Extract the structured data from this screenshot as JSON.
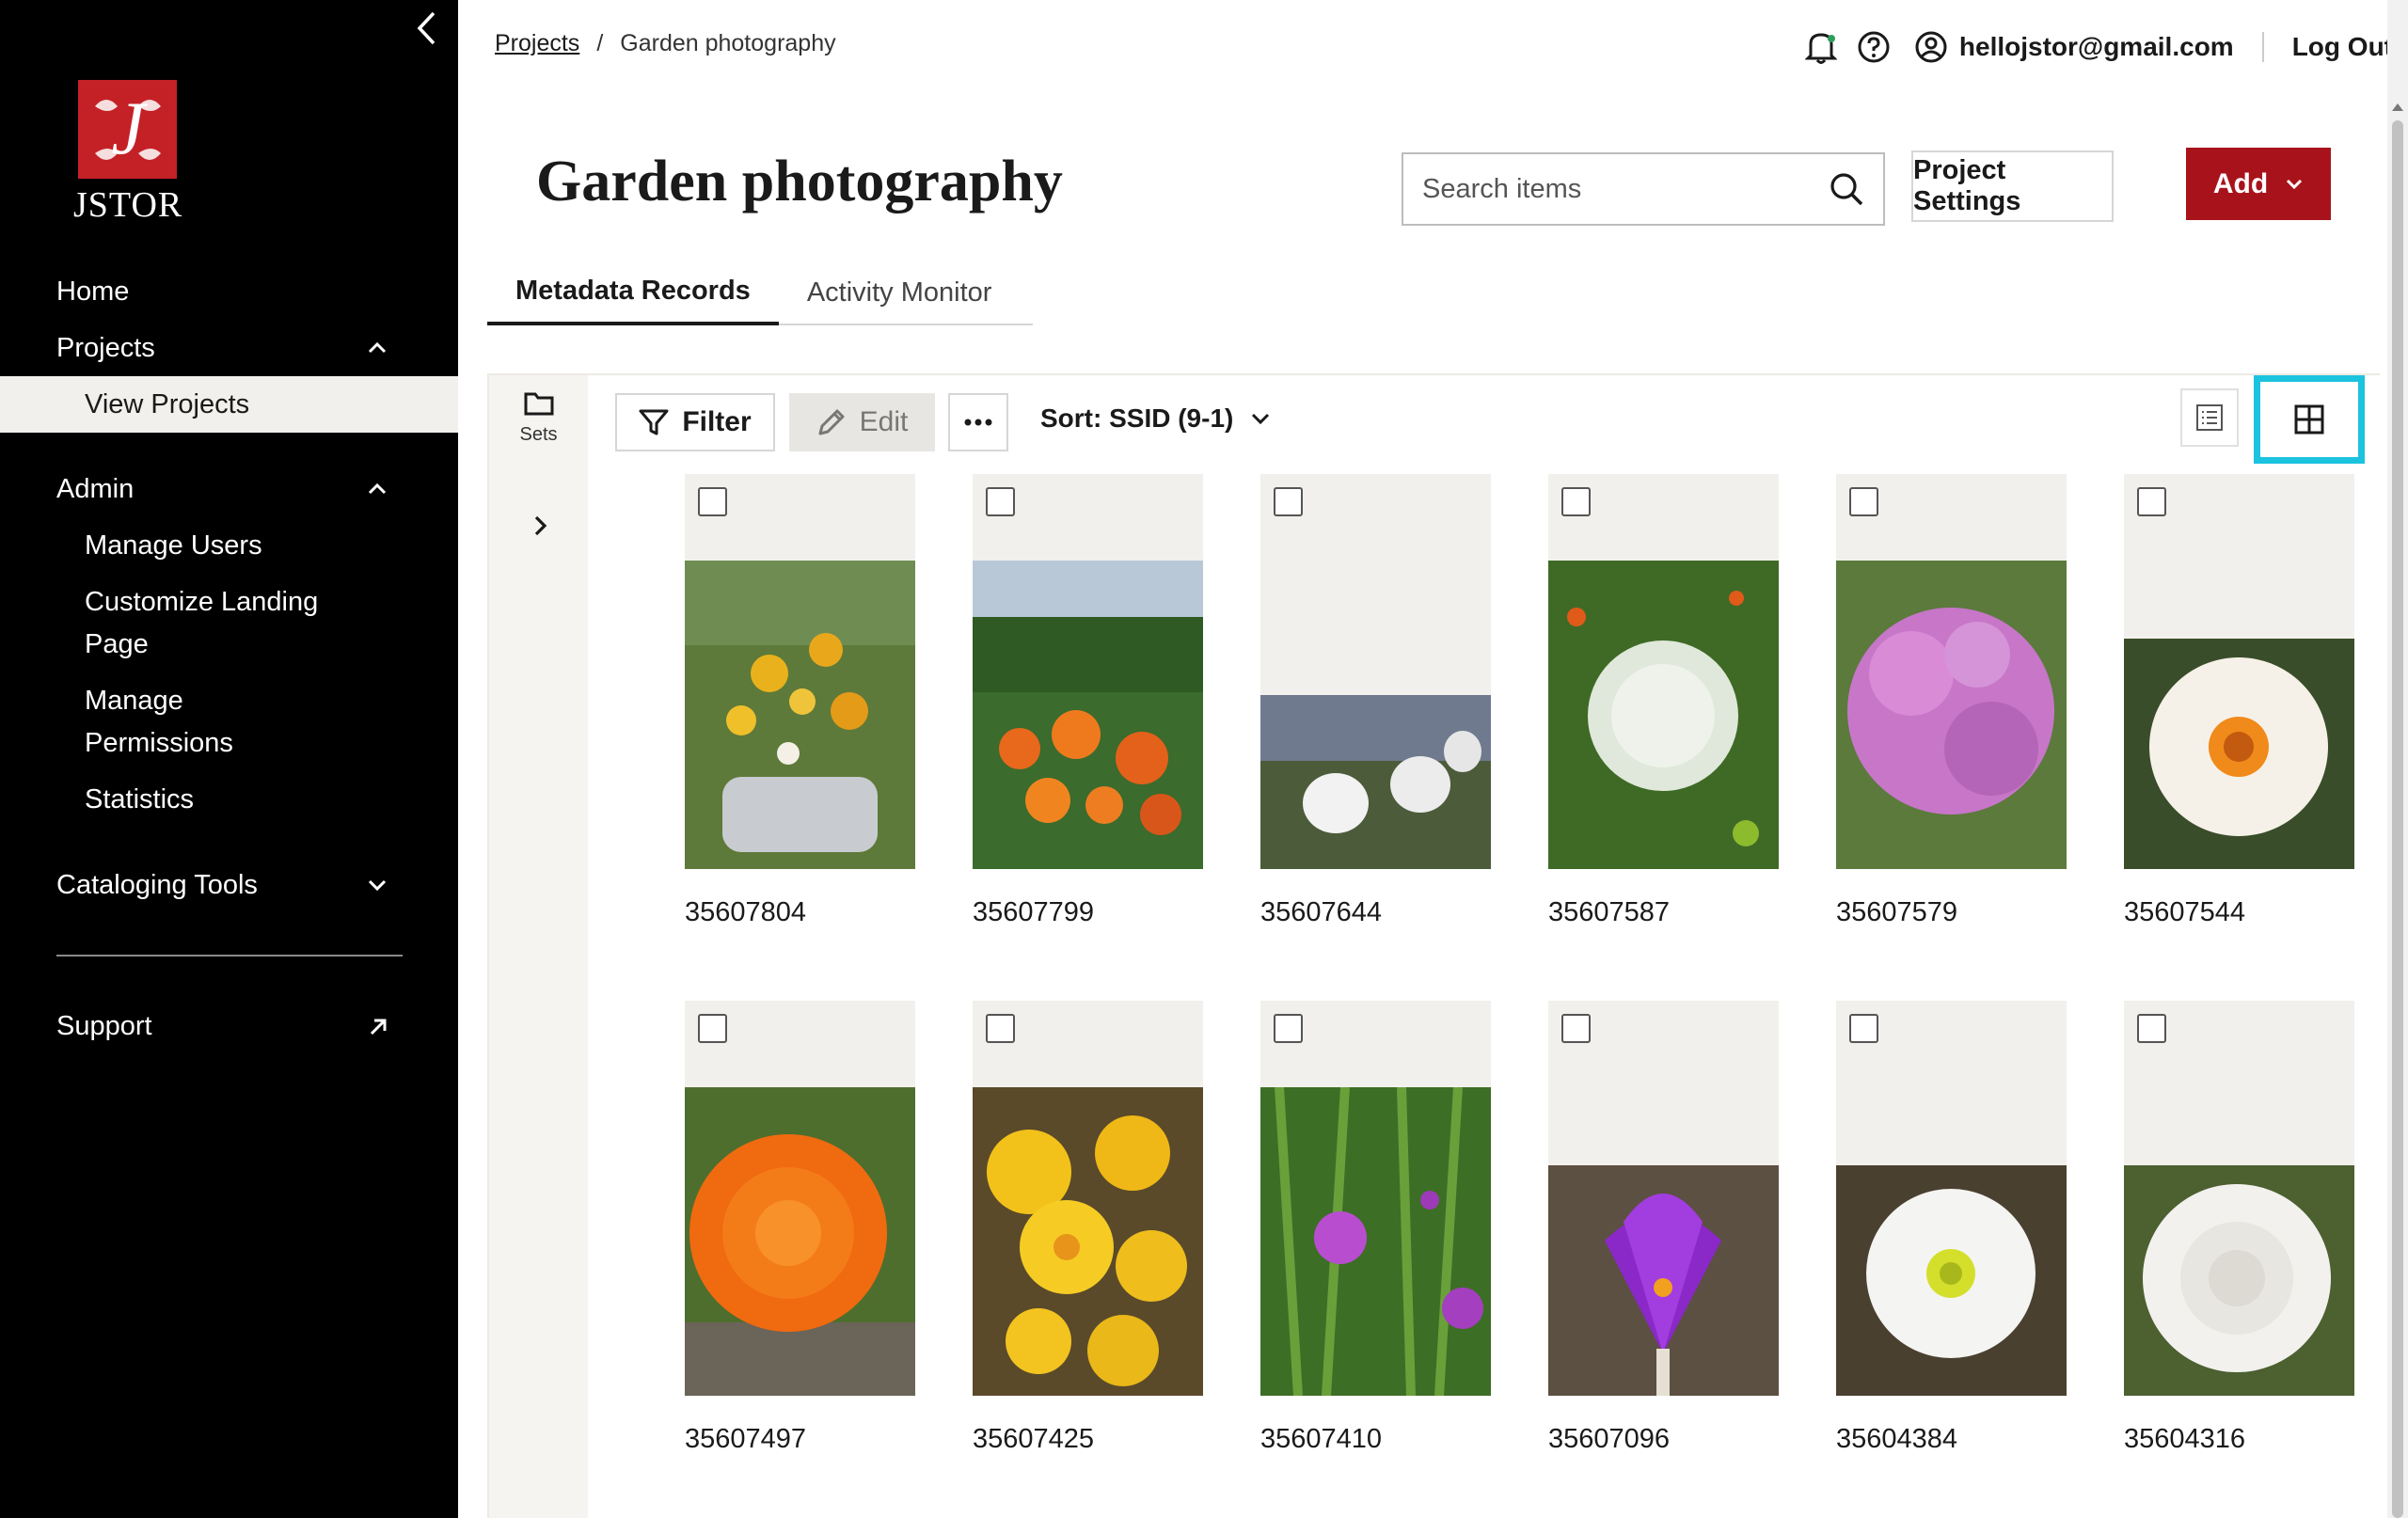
{
  "sidebar": {
    "logo_text": "JSTOR",
    "nav": {
      "home": "Home",
      "projects": "Projects",
      "view_projects": "View Projects",
      "admin": "Admin",
      "manage_users": "Manage Users",
      "customize_landing_1": "Customize Landing",
      "customize_landing_2": "Page",
      "manage_permissions_1": "Manage",
      "manage_permissions_2": "Permissions",
      "statistics": "Statistics",
      "cataloging_tools": "Cataloging Tools",
      "support": "Support"
    }
  },
  "header": {
    "breadcrumb_root": "Projects",
    "breadcrumb_sep": "/",
    "breadcrumb_current": "Garden photography",
    "user_email": "hellojstor@gmail.com",
    "logout": "Log Out"
  },
  "page": {
    "title": "Garden photography",
    "search_placeholder": "Search items",
    "settings_label": "Project Settings",
    "add_label": "Add"
  },
  "tabs": {
    "metadata": "Metadata Records",
    "activity": "Activity Monitor"
  },
  "toolbar": {
    "sets_label": "Sets",
    "filter_label": "Filter",
    "edit_label": "Edit",
    "sort_label": "Sort: SSID (9-1)"
  },
  "items": [
    {
      "id": "35607804",
      "subject": "yellow-flower-planter"
    },
    {
      "id": "35607799",
      "subject": "orange-marigolds"
    },
    {
      "id": "35607644",
      "subject": "white-tulips"
    },
    {
      "id": "35607587",
      "subject": "queen-annes-lace"
    },
    {
      "id": "35607579",
      "subject": "pink-hydrangea"
    },
    {
      "id": "35607544",
      "subject": "white-daffodil"
    },
    {
      "id": "35607497",
      "subject": "orange-zinnia"
    },
    {
      "id": "35607425",
      "subject": "yellow-daffodils"
    },
    {
      "id": "35607410",
      "subject": "purple-spiderwort"
    },
    {
      "id": "35607096",
      "subject": "purple-crocus"
    },
    {
      "id": "35604384",
      "subject": "white-anemone"
    },
    {
      "id": "35604316",
      "subject": "white-rose"
    }
  ]
}
